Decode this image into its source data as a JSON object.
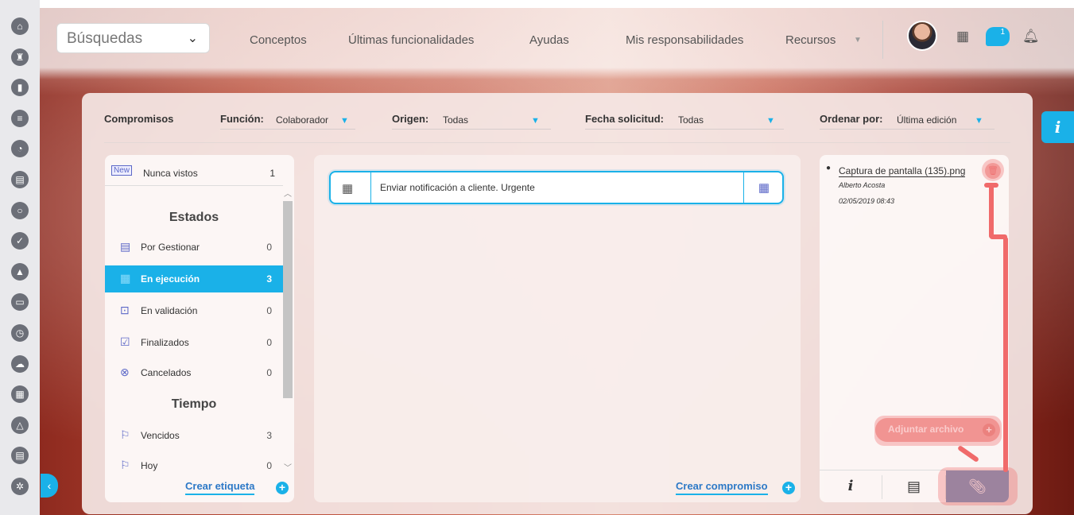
{
  "topbar": {
    "search_select": "Búsquedas",
    "nav": [
      "Conceptos",
      "Últimas funcionalidades",
      "Ayudas",
      "Mis responsabilidades",
      "Recursos"
    ],
    "message_badge": "1"
  },
  "filters": {
    "compromisos": "Compromisos",
    "funcion_label": "Función:",
    "funcion_value": "Colaborador",
    "origen_label": "Origen:",
    "origen_value": "Todas",
    "fecha_label": "Fecha solicitud:",
    "fecha_value": "Todas",
    "ordenar_label": "Ordenar por:",
    "ordenar_value": "Última edición"
  },
  "left_panel": {
    "new_badge": "New",
    "nunca_vistos_label": "Nunca vistos",
    "nunca_vistos_count": "1",
    "estados_title": "Estados",
    "estados": [
      {
        "label": "Por Gestionar",
        "count": "0"
      },
      {
        "label": "En ejecución",
        "count": "3"
      },
      {
        "label": "En validación",
        "count": "0"
      },
      {
        "label": "Finalizados",
        "count": "0"
      },
      {
        "label": "Cancelados",
        "count": "0"
      }
    ],
    "tiempo_title": "Tiempo",
    "tiempo": [
      {
        "label": "Vencidos",
        "count": "3"
      },
      {
        "label": "Hoy",
        "count": "0"
      }
    ],
    "crear_etiqueta": "Crear etiqueta"
  },
  "center_panel": {
    "task_title": "Enviar notificación a cliente. Urgente",
    "crear_compromiso": "Crear compromiso"
  },
  "right_panel": {
    "file_name": "Captura de pantalla (135).png",
    "file_author": "Alberto Acosta",
    "file_date": "02/05/2019 08:43",
    "attach_button": "Adjuntar archivo",
    "tab_info": "i"
  },
  "side_info_tab": "i",
  "colors": {
    "accent": "#1ab1e8",
    "annotation": "#f06a6a",
    "active_tab": "#6f8fb8"
  }
}
